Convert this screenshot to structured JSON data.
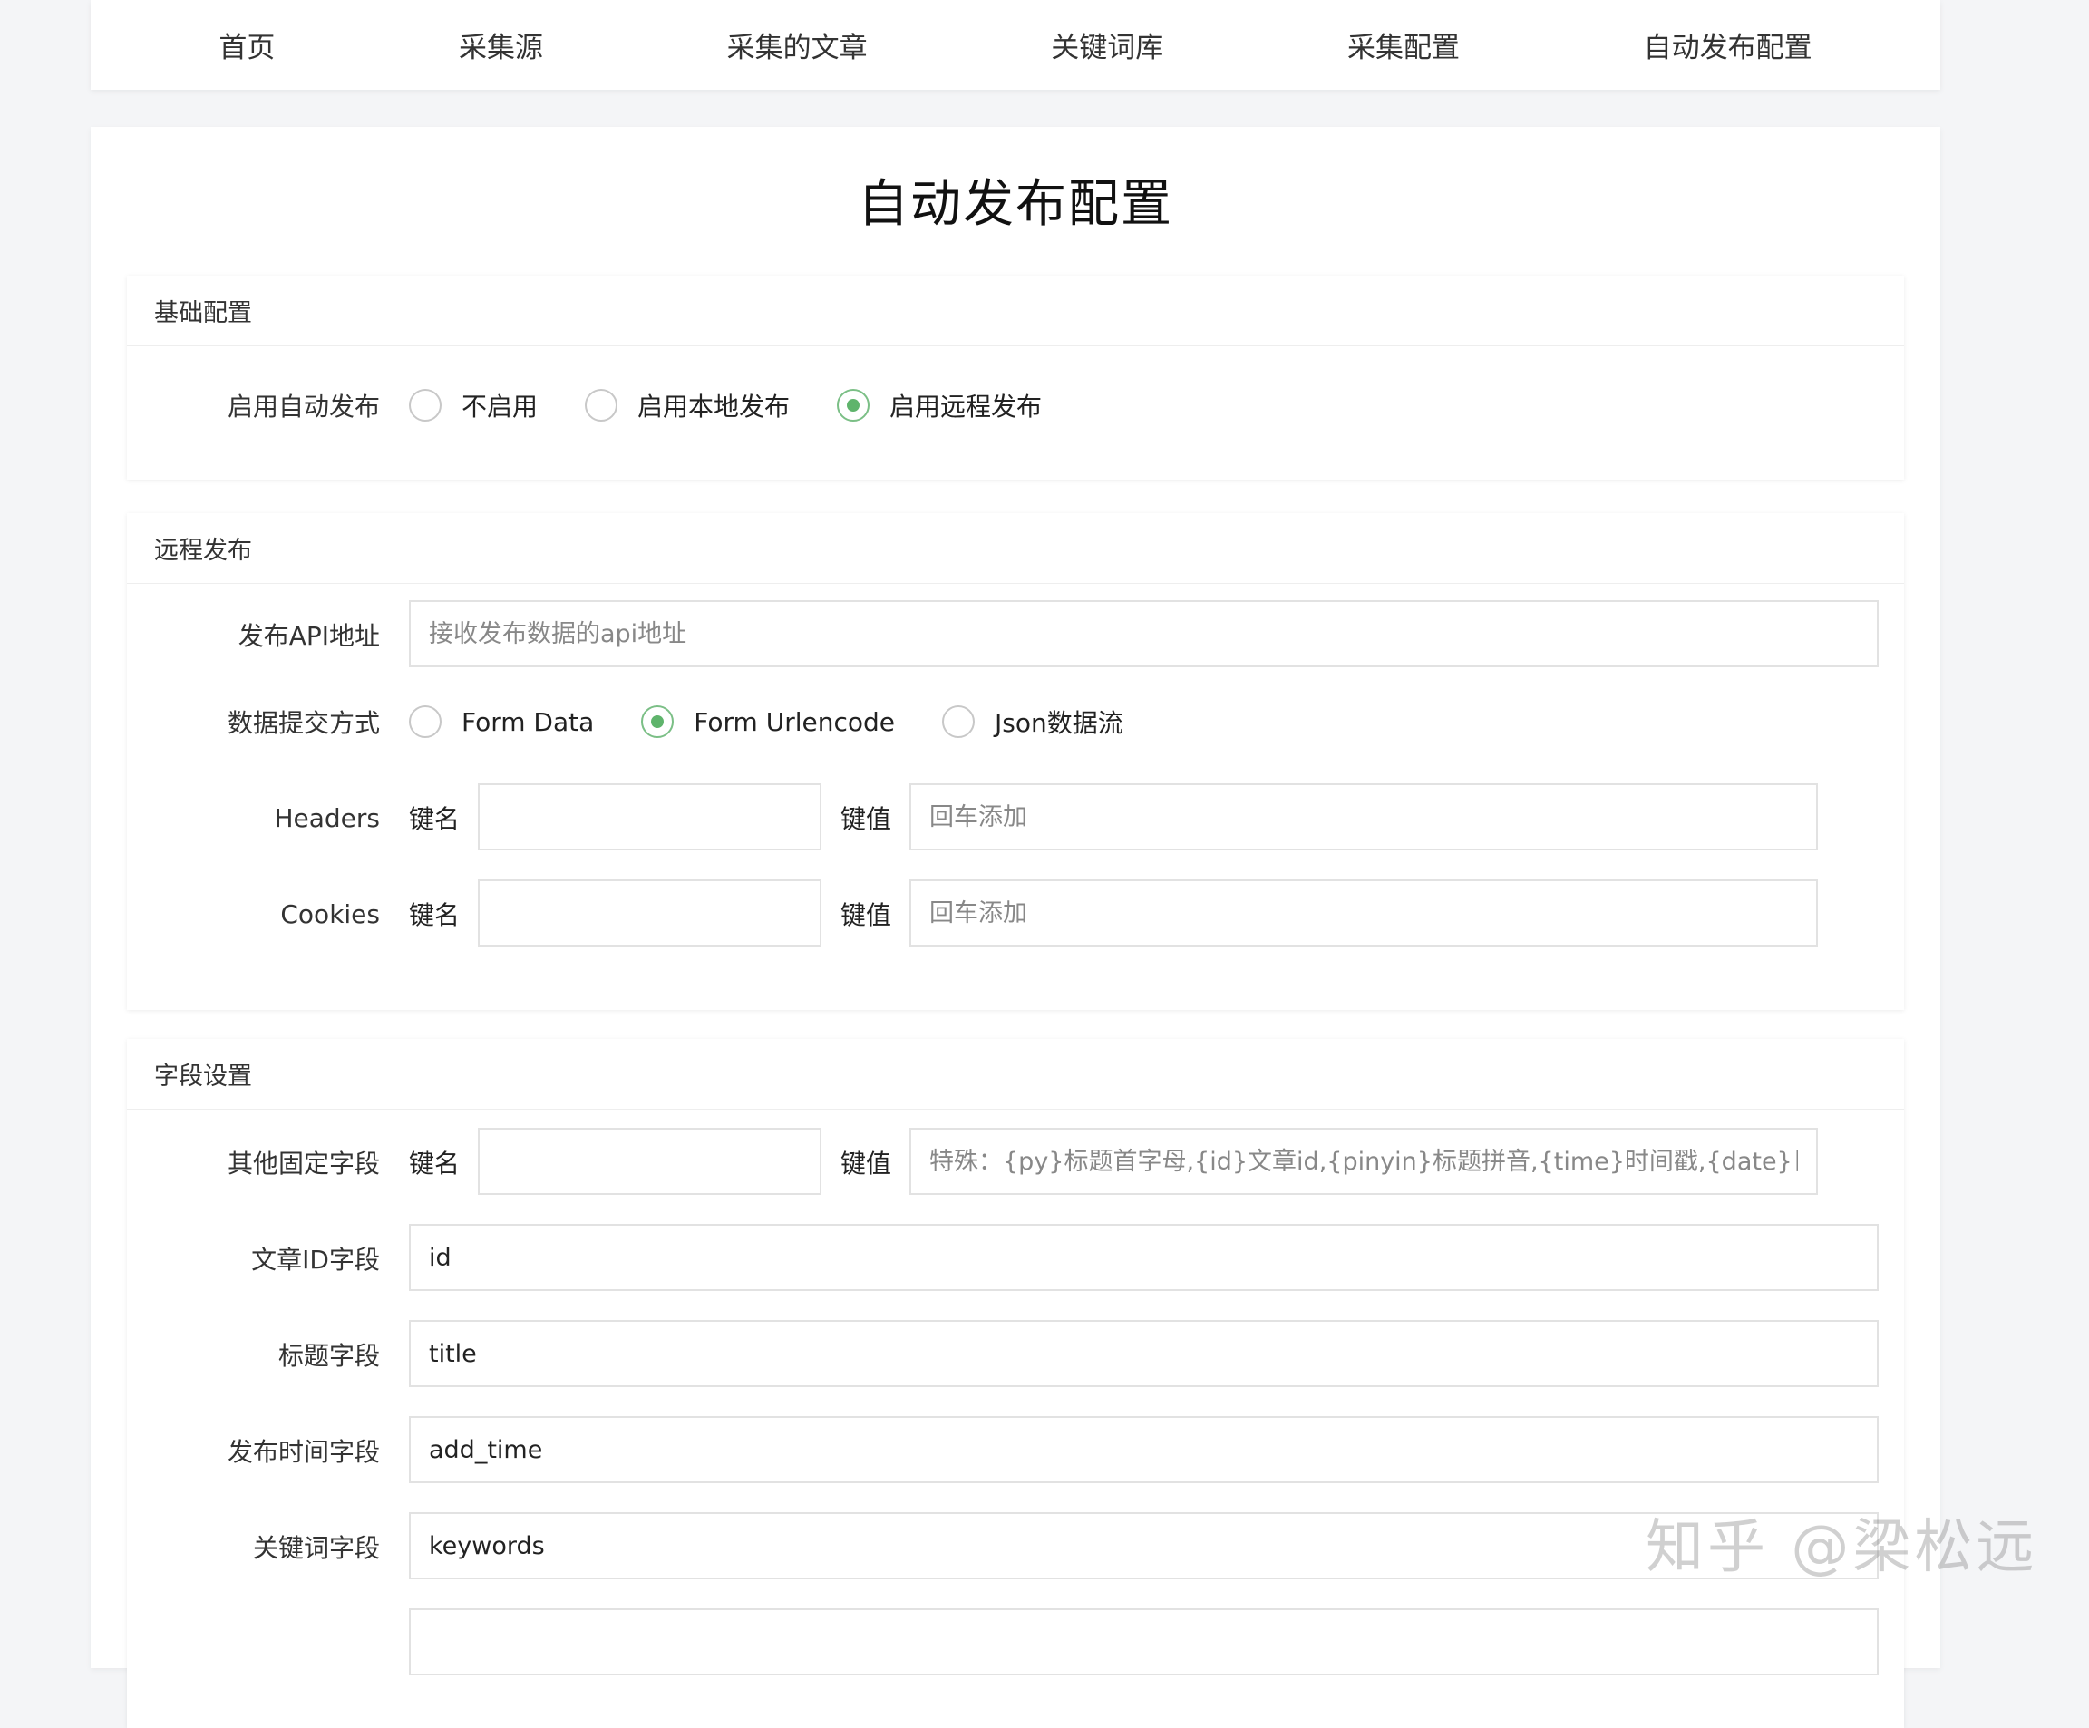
{
  "nav": {
    "items": [
      "首页",
      "采集源",
      "采集的文章",
      "关键词库",
      "采集配置",
      "自动发布配置"
    ]
  },
  "page_title": "自动发布配置",
  "basic": {
    "header": "基础配置",
    "enable_label": "启用自动发布",
    "options": [
      "不启用",
      "启用本地发布",
      "启用远程发布"
    ],
    "selected": "启用远程发布"
  },
  "remote": {
    "header": "远程发布",
    "api_label": "发布API地址",
    "api_placeholder": "接收发布数据的api地址",
    "submit_label": "数据提交方式",
    "submit_options": [
      "Form Data",
      "Form Urlencode",
      "Json数据流"
    ],
    "submit_selected": "Form Urlencode",
    "headers_label": "Headers",
    "cookies_label": "Cookies",
    "key_label": "键名",
    "value_label": "键值",
    "value_placeholder": "回车添加"
  },
  "fields": {
    "header": "字段设置",
    "other_label": "其他固定字段",
    "key_label": "键名",
    "value_label": "键值",
    "other_placeholder": "特殊：{py}标题首字母,{id}文章id,{pinyin}标题拼音,{time}时间戳,{date}日期",
    "article_id_label": "文章ID字段",
    "article_id_value": "id",
    "title_label": "标题字段",
    "title_value": "title",
    "time_label": "发布时间字段",
    "time_value": "add_time",
    "keywords_label": "关键词字段",
    "keywords_value": "keywords"
  },
  "watermark": "知乎 @梁松远"
}
